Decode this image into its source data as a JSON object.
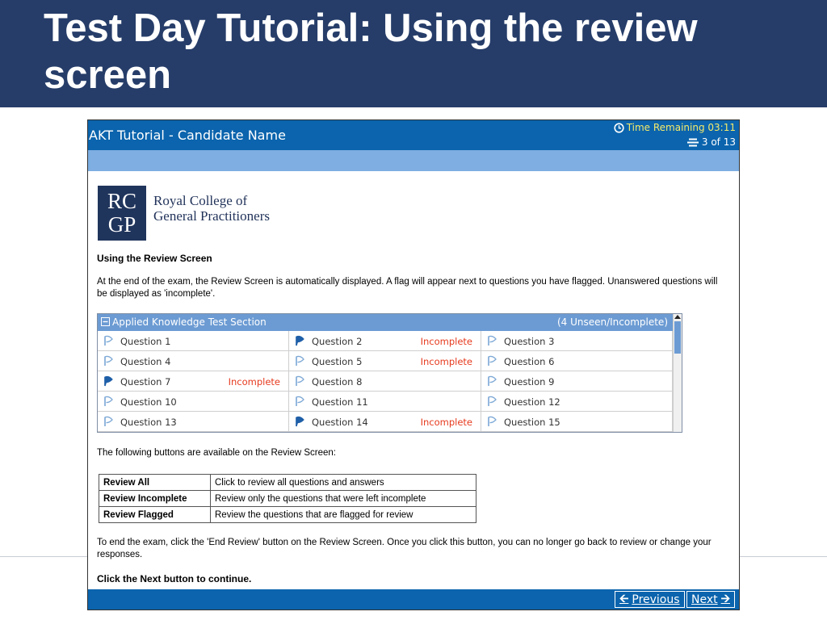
{
  "slide": {
    "title": "Test Day Tutorial: Using the review screen"
  },
  "app": {
    "title": "AKT Tutorial - Candidate Name",
    "time_remaining": "Time Remaining 03:11",
    "question_count": "3 of 13"
  },
  "logo": {
    "line1": "RC",
    "line2": "GP",
    "org_line1": "Royal College of",
    "org_line2": "General Practitioners"
  },
  "content": {
    "heading": "Using the Review Screen",
    "intro": "At the end of the exam, the Review Screen is automatically displayed. A flag will appear next to questions you have flagged. Unanswered questions will be displayed as 'incomplete'.",
    "buttons_intro": "The following buttons are available on the Review Screen:",
    "end_text": "To end the exam, click the 'End Review' button on the Review Screen. Once you click this button, you can no longer go back to review or change your responses.",
    "next_text": "Click the Next button to continue."
  },
  "review_panel": {
    "title": "Applied Knowledge Test Section",
    "count": "(4 Unseen/Incomplete)",
    "questions": [
      {
        "label": "Question 1",
        "status": "",
        "flagged": false
      },
      {
        "label": "Question 2",
        "status": "Incomplete",
        "flagged": true
      },
      {
        "label": "Question 3",
        "status": "",
        "flagged": false
      },
      {
        "label": "Question 4",
        "status": "",
        "flagged": false
      },
      {
        "label": "Question 5",
        "status": "Incomplete",
        "flagged": false
      },
      {
        "label": "Question 6",
        "status": "",
        "flagged": false
      },
      {
        "label": "Question 7",
        "status": "Incomplete",
        "flagged": true
      },
      {
        "label": "Question 8",
        "status": "",
        "flagged": false
      },
      {
        "label": "Question 9",
        "status": "",
        "flagged": false
      },
      {
        "label": "Question 10",
        "status": "",
        "flagged": false
      },
      {
        "label": "Question 11",
        "status": "",
        "flagged": false
      },
      {
        "label": "Question 12",
        "status": "",
        "flagged": false
      },
      {
        "label": "Question 13",
        "status": "",
        "flagged": false
      },
      {
        "label": "Question 14",
        "status": "Incomplete",
        "flagged": true
      },
      {
        "label": "Question 15",
        "status": "",
        "flagged": false
      }
    ]
  },
  "buttons_table": [
    {
      "name": "Review All",
      "description": "Click to review all questions and answers"
    },
    {
      "name": "Review Incomplete",
      "description": "Review only the questions that were left incomplete"
    },
    {
      "name": "Review Flagged",
      "description": "Review the questions that are flagged for review"
    }
  ],
  "footer": {
    "previous": "Previous",
    "next": "Next"
  },
  "icons": {
    "clock": "clock-icon",
    "count": "question-count-icon",
    "collapse": "collapse-icon",
    "flag_empty": "flag-outline-icon",
    "flag_filled": "flag-filled-icon",
    "prev_arrow": "arrow-left-icon",
    "next_arrow": "arrow-right-icon"
  },
  "colors": {
    "slide_header": "#263d69",
    "titlebar": "#0b64ad",
    "subbar": "#7eaee2",
    "panel_header": "#6c9bd3",
    "incomplete": "#e63a1e",
    "time_text": "#f5e96a",
    "flag_filled": "#1f5fa8",
    "flag_outline": "#7ea9d6"
  }
}
